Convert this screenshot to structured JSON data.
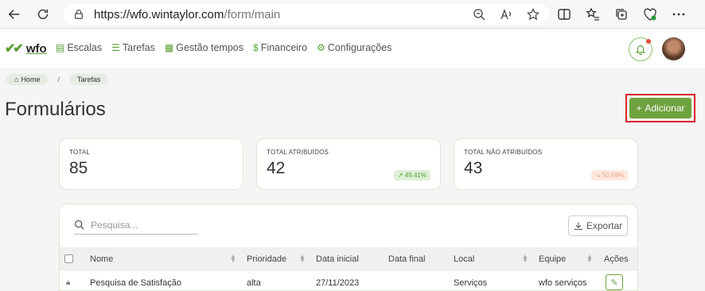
{
  "browser": {
    "url_host": "https://wfo.wintaylor.com",
    "url_path": "/form/main"
  },
  "header": {
    "logo_text": "wfo",
    "menu": [
      {
        "label": "Escalas",
        "icon": "calendar-icon"
      },
      {
        "label": "Tarefas",
        "icon": "list-icon"
      },
      {
        "label": "Gestão tempos",
        "icon": "calculator-icon"
      },
      {
        "label": "Financeiro",
        "icon": "dollar-icon"
      },
      {
        "label": "Configurações",
        "icon": "gear-icon"
      }
    ]
  },
  "breadcrumb": {
    "home": "Home",
    "separator": "/",
    "current": "Tarefas"
  },
  "page": {
    "title": "Formulários",
    "add_label": "Adicionar"
  },
  "stats": [
    {
      "label": "TOTAL",
      "value": "85",
      "badge": ""
    },
    {
      "label": "TOTAL ATRIBUÍDOS",
      "value": "42",
      "badge": "49.41%",
      "trend": "up"
    },
    {
      "label": "TOTAL NÃO ATRIBUÍDOS",
      "value": "43",
      "badge": "50.59%",
      "trend": "down"
    }
  ],
  "table": {
    "search_placeholder": "Pesquisa...",
    "export_label": "Exportar",
    "columns": [
      "Nome",
      "Prioridade",
      "Data inicial",
      "Data final",
      "Local",
      "Equipe",
      "Ações"
    ],
    "rows": [
      {
        "nome": "Pesquisa de Satisfação",
        "prioridade": "alta",
        "data_inicial": "27/11/2023",
        "data_final": "",
        "local": "Serviços",
        "equipe": "wfo serviços"
      }
    ]
  },
  "colors": {
    "accent": "#6fa13e",
    "highlight_border": "#d9232d"
  }
}
